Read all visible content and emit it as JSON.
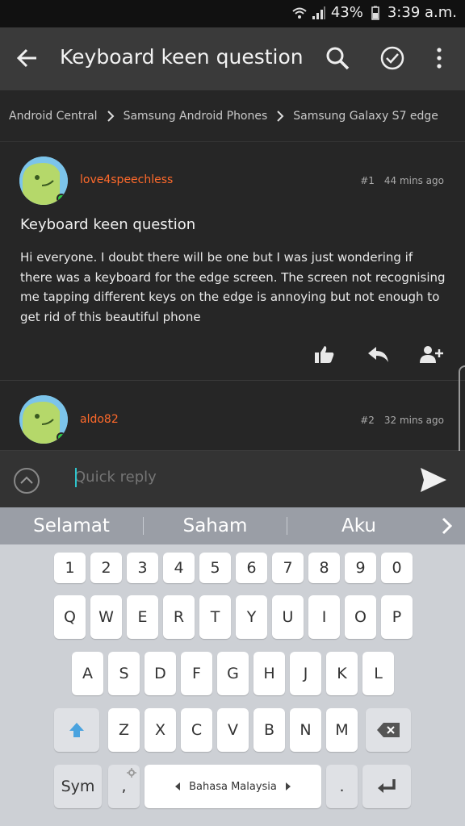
{
  "status": {
    "battery": "43%",
    "time": "3:39 a.m."
  },
  "appbar": {
    "title": "Keyboard keen question"
  },
  "breadcrumb": [
    "Android Central",
    "Samsung Android Phones",
    "Samsung Galaxy S7 edge"
  ],
  "posts": [
    {
      "username": "love4speechless",
      "number": "#1",
      "time": "44 mins ago",
      "title": "Keyboard keen question",
      "body": "Hi everyone. I doubt there will be one but I was just wondering if there was a keyboard for the edge screen. The screen not recognising me tapping different keys on the edge is annoying but not enough to get rid of this beautiful phone"
    },
    {
      "username": "aldo82",
      "number": "#2",
      "time": "32 mins ago"
    }
  ],
  "quick_reply": {
    "placeholder": "Quick reply"
  },
  "suggestions": [
    "Selamat",
    "Saham",
    "Aku"
  ],
  "keyboard": {
    "row1": [
      "1",
      "2",
      "3",
      "4",
      "5",
      "6",
      "7",
      "8",
      "9",
      "0"
    ],
    "row2": [
      "Q",
      "W",
      "E",
      "R",
      "T",
      "Y",
      "U",
      "I",
      "O",
      "P"
    ],
    "row3": [
      "A",
      "S",
      "D",
      "F",
      "G",
      "H",
      "J",
      "K",
      "L"
    ],
    "row4": [
      "Z",
      "X",
      "C",
      "V",
      "B",
      "N",
      "M"
    ],
    "sym": "Sym",
    "comma": ",",
    "space": "Bahasa Malaysia",
    "period": "."
  },
  "colors": {
    "accent": "#ff6a2b",
    "cursor": "#2ec4cc",
    "shift": "#4aa3df"
  }
}
